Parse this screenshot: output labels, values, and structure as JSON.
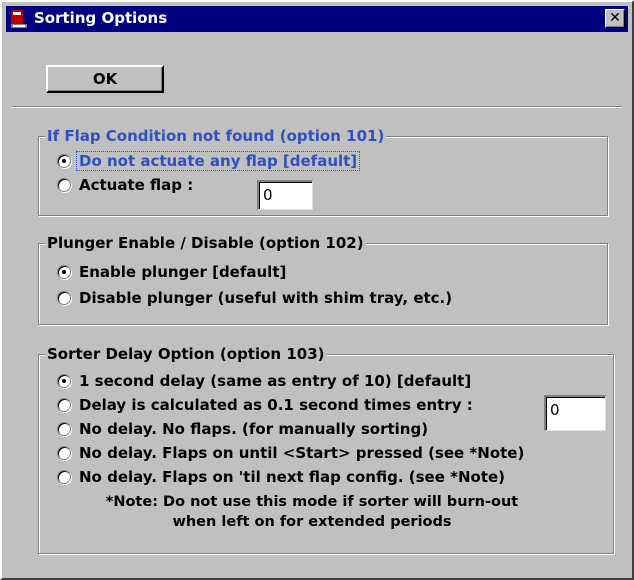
{
  "window": {
    "title": "Sorting Options",
    "close_glyph": "✕"
  },
  "toolbar": {
    "ok_label": "OK"
  },
  "flap_group": {
    "legend": "If Flap Condition not found (option 101)",
    "options": [
      {
        "label": "Do not actuate any flap [default]",
        "selected": true
      },
      {
        "label": "Actuate flap :",
        "selected": false
      }
    ],
    "flap_value": "0"
  },
  "plunger_group": {
    "legend": "Plunger Enable / Disable (option 102)",
    "options": [
      {
        "label": "Enable plunger [default]",
        "selected": true
      },
      {
        "label": "Disable plunger (useful with shim tray, etc.)",
        "selected": false
      }
    ]
  },
  "delay_group": {
    "legend": "Sorter Delay Option (option 103)",
    "options": [
      {
        "label": "1 second delay (same as entry of 10) [default]",
        "selected": true
      },
      {
        "label": "Delay is calculated as 0.1 second times entry :",
        "selected": false
      },
      {
        "label": "No delay. No flaps. (for manually sorting)",
        "selected": false
      },
      {
        "label": "No delay. Flaps on until <Start> pressed (see *Note)",
        "selected": false
      },
      {
        "label": "No delay. Flaps on 'til next flap config. (see *Note)",
        "selected": false
      }
    ],
    "delay_value": "0",
    "note_line1": "*Note: Do not use this mode if sorter will burn-out",
    "note_line2": "when left on for extended periods"
  }
}
